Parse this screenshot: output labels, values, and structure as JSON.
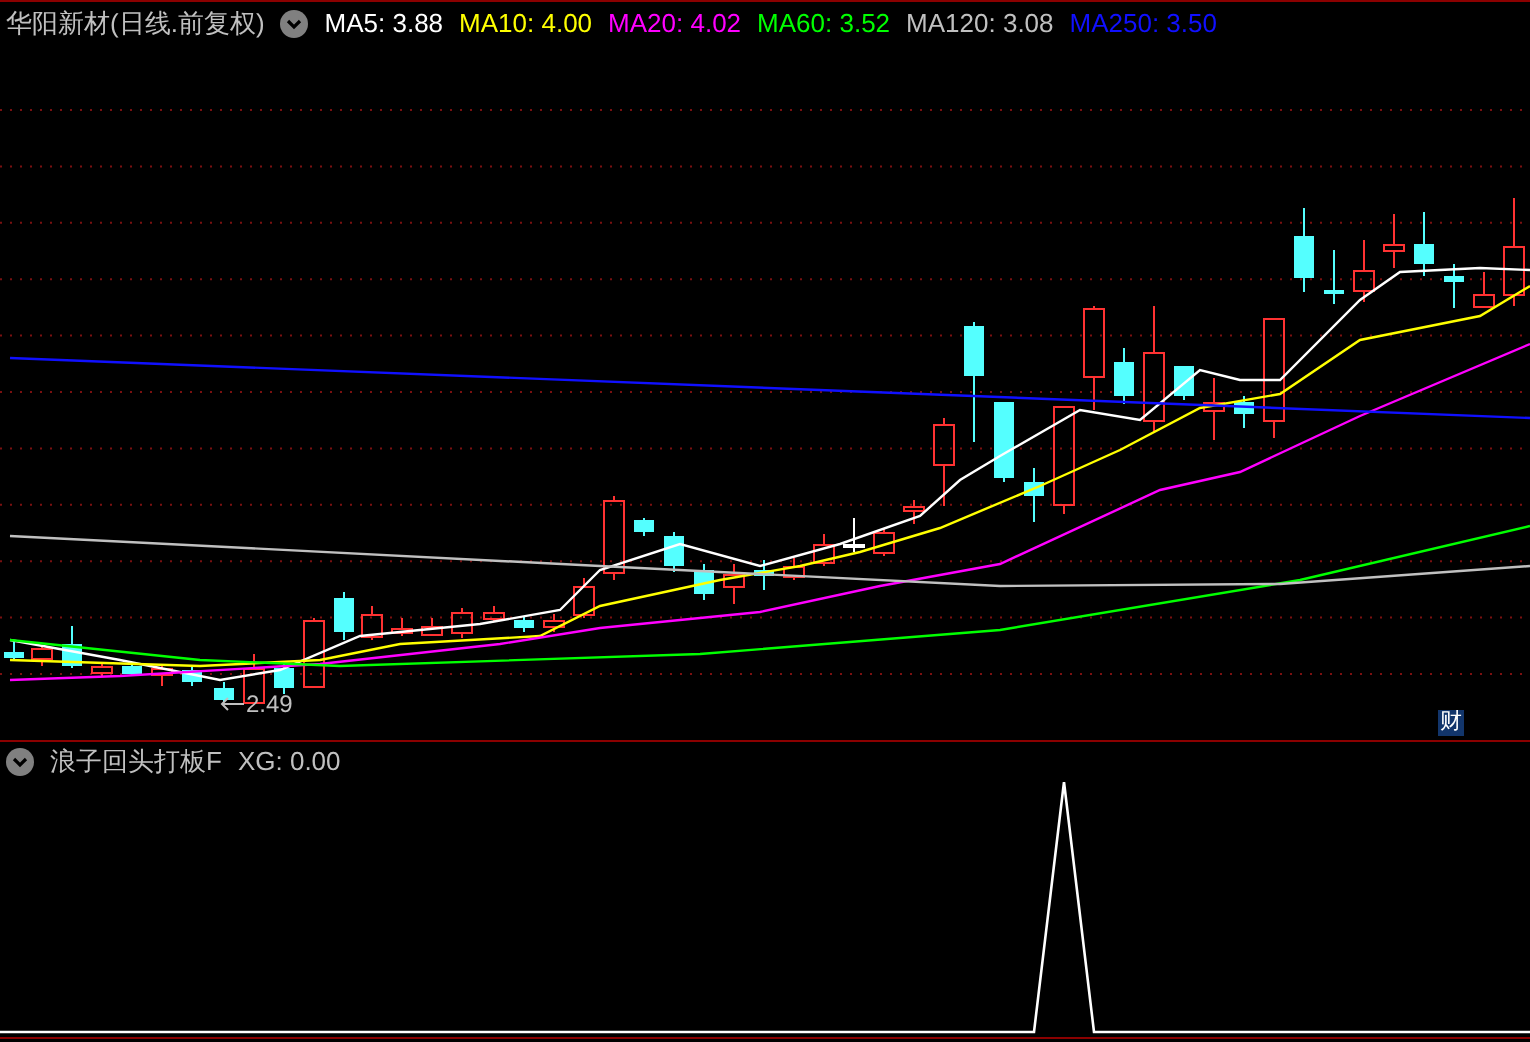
{
  "title": "华阳新材(日线.前复权)",
  "moving_averages": [
    {
      "text": "MA5: 3.88",
      "color": "#ffffff"
    },
    {
      "text": "MA10: 4.00",
      "color": "#ffff00"
    },
    {
      "text": "MA20: 4.02",
      "color": "#ff00ff"
    },
    {
      "text": "MA60: 3.52",
      "color": "#00ff00"
    },
    {
      "text": "MA120: 3.08",
      "color": "#c0c0c0"
    },
    {
      "text": "MA250: 3.50",
      "color": "#1010ff"
    }
  ],
  "low_marker": "2.49",
  "badge": "财",
  "indicator": {
    "name": "浪子回头打板F",
    "readout": "XG: 0.00"
  }
}
